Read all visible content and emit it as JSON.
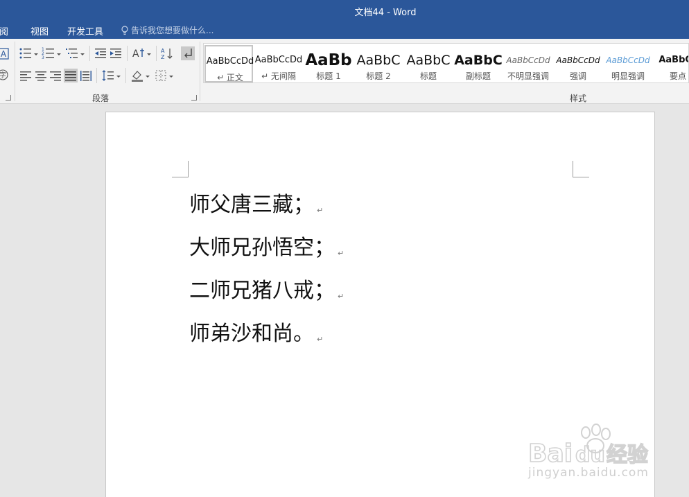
{
  "window": {
    "title": "文档44 - Word"
  },
  "tabs": [
    {
      "label": "审阅",
      "clip": "阅"
    },
    {
      "label": "视图"
    },
    {
      "label": "开发工具"
    }
  ],
  "tell_me": {
    "placeholder": "告诉我您想要做什么..."
  },
  "ribbon": {
    "paragraph_group_label": "段落",
    "styles_group_label": "样式",
    "styles": [
      {
        "preview": "AaBbCcDd",
        "label": "↵ 正文",
        "selected": true
      },
      {
        "preview": "AaBbCcDd",
        "label": "↵ 无间隔"
      },
      {
        "preview": "AaBb",
        "label": "标题 1"
      },
      {
        "preview": "AaBbC",
        "label": "标题 2"
      },
      {
        "preview": "AaBbC",
        "label": "标题"
      },
      {
        "preview": "AaBbC",
        "label": "副标题"
      },
      {
        "preview": "AaBbCcDd",
        "label": "不明显强调"
      },
      {
        "preview": "AaBbCcDd",
        "label": "强调"
      },
      {
        "preview": "AaBbCcDd",
        "label": "明显强调"
      },
      {
        "preview": "AaBbCc",
        "label": "要点"
      }
    ]
  },
  "document": {
    "lines": [
      {
        "text": "师父唐三藏；",
        "mark": "↵"
      },
      {
        "text": "大师兄孙悟空；",
        "mark": "↵"
      },
      {
        "text": "二师兄猪八戒；",
        "mark": "↵"
      },
      {
        "text": "师弟沙和尚。",
        "mark": "↵"
      }
    ]
  },
  "watermark": {
    "logo": "Baidu经验",
    "url": "jingyan.baidu.com"
  },
  "colors": {
    "accent": "#2b579a",
    "ribbon": "#f3f3f3",
    "canvas": "#e6e6e6"
  }
}
